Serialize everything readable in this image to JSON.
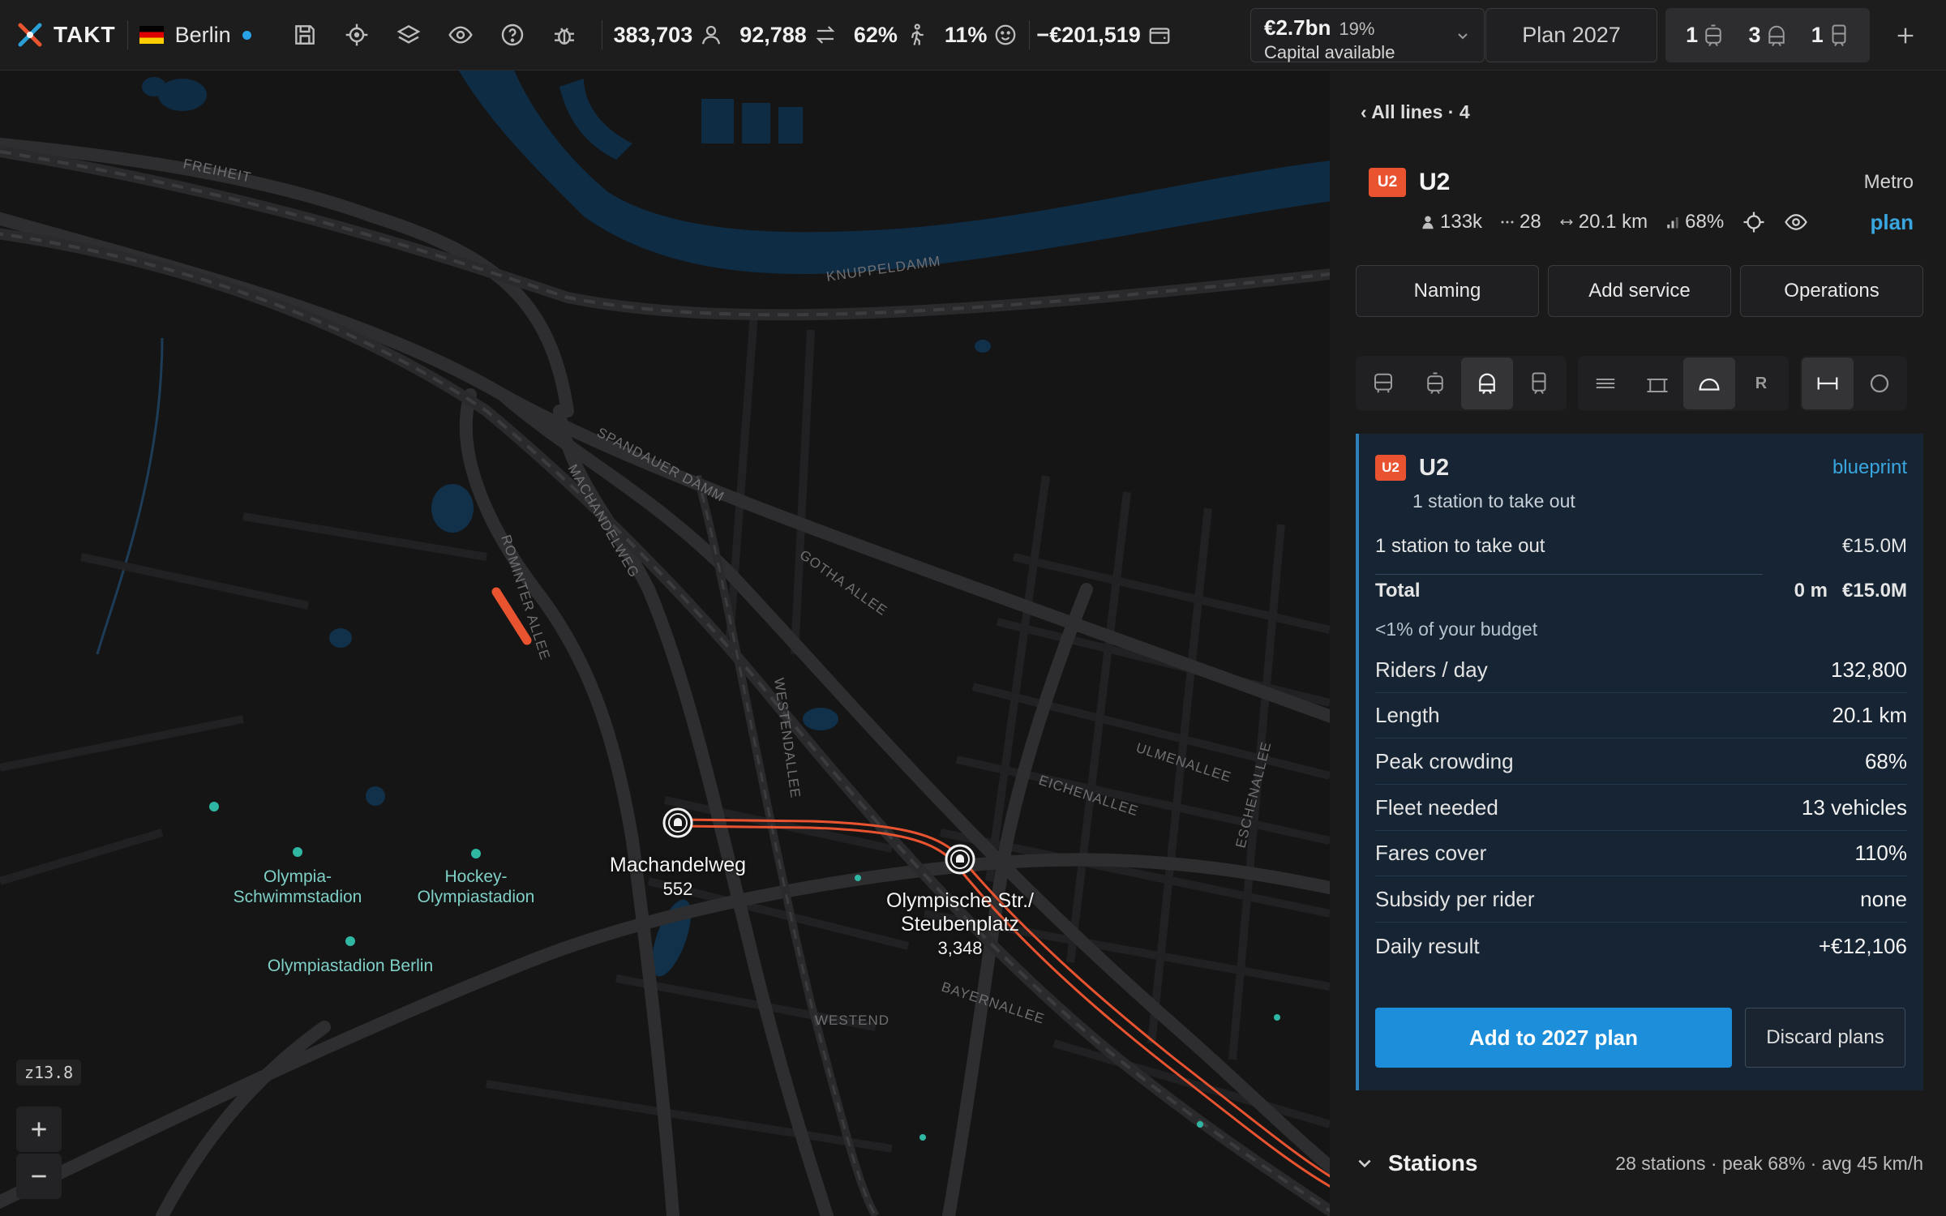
{
  "app": {
    "name": "TAKT",
    "city": "Berlin"
  },
  "topbar": {
    "population": "383,703",
    "trips": "92,788",
    "walk_share": "62%",
    "satisfaction": "11%",
    "cashflow": "−€201,519",
    "capital": {
      "value": "€2.7bn",
      "percent": "19%",
      "label": "Capital available"
    },
    "plan_label": "Plan 2027",
    "fleet": [
      {
        "count": "1",
        "icon": "tram-icon"
      },
      {
        "count": "3",
        "icon": "metro-icon"
      },
      {
        "count": "1",
        "icon": "train-icon"
      }
    ],
    "icons": [
      "save-icon",
      "locate-icon",
      "layers-icon",
      "eye-icon",
      "help-icon",
      "bug-icon"
    ]
  },
  "map": {
    "zoom": "z13.8",
    "stations": [
      {
        "name": "Machandelweg",
        "riders": "552"
      },
      {
        "name": "Olympische Str./ Steubenplatz",
        "line1": "Olympische Str./",
        "line2": "Steubenplatz",
        "riders": "3,348"
      }
    ],
    "pois": [
      {
        "line1": "Olympia-",
        "line2": "Schwimmstadion"
      },
      {
        "line1": "Hockey-",
        "line2": "Olympiastadion"
      },
      {
        "line1": "Olympiastadion Berlin",
        "line2": ""
      }
    ],
    "street_labels": [
      "FREIHEIT",
      "KNUPPELDAMM",
      "SPANDAUER DAMM",
      "MACHANDELWEG",
      "ROMINTER ALLEE",
      "GOTHA ALLEE",
      "WESTENDALLEE",
      "ULMENALLEE",
      "EICHENALLEE",
      "ESCHENALLEE",
      "BAYERNALLEE",
      "WESTEND"
    ],
    "line_color": "#e9532f"
  },
  "panel": {
    "back_label": "‹ All lines · 4",
    "line": {
      "badge": "U2",
      "name": "U2",
      "mode": "Metro",
      "riders": "133k",
      "stations": "28",
      "length": "20.1 km",
      "crowding": "68%",
      "plan_link": "plan"
    },
    "actions": [
      "Naming",
      "Add service",
      "Operations"
    ],
    "mode_buttons": {
      "vehicles": [
        "bus-icon",
        "tram-icon",
        "metro-icon",
        "train-icon"
      ],
      "track": [
        "surface-icon",
        "elevated-icon",
        "tunnel-icon",
        "R"
      ],
      "shape": [
        "linear-icon",
        "loop-icon"
      ]
    },
    "card": {
      "badge": "U2",
      "name": "U2",
      "tag": "blueprint",
      "subtitle": "1 station to take out",
      "cost_rows": [
        {
          "label": "1 station to take out",
          "value": "€15.0M"
        }
      ],
      "total": {
        "label": "Total",
        "length": "0 m",
        "value": "€15.0M"
      },
      "budget_note": "<1% of your budget",
      "metrics": [
        {
          "label": "Riders / day",
          "value": "132,800"
        },
        {
          "label": "Length",
          "value": "20.1 km"
        },
        {
          "label": "Peak crowding",
          "value": "68%"
        },
        {
          "label": "Fleet needed",
          "value": "13 vehicles"
        },
        {
          "label": "Fares cover",
          "value": "110%"
        },
        {
          "label": "Subsidy per rider",
          "value": "none"
        },
        {
          "label": "Daily result",
          "value": "+€12,106"
        }
      ],
      "primary_button": "Add to 2027 plan",
      "secondary_button": "Discard plans"
    },
    "stations_section": {
      "title": "Stations",
      "summary": "28 stations · peak 68% · avg 45 km/h"
    }
  }
}
